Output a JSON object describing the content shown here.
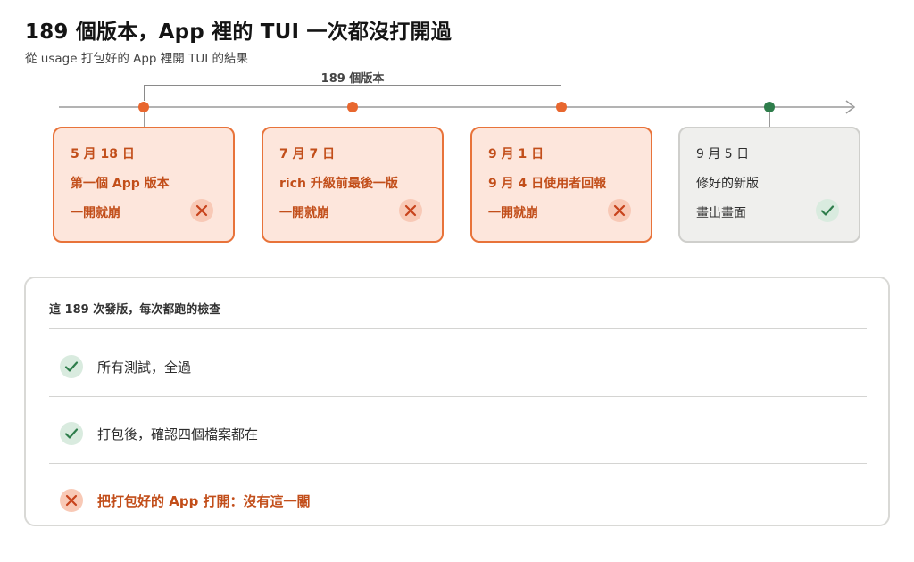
{
  "title": "189 個版本，App 裡的 TUI 一次都沒打開過",
  "subtitle": "從 usage 打包好的 App 裡開 TUI 的結果",
  "bracket_label": "189 個版本",
  "colors": {
    "fail_accent": "#e8672f",
    "fail_text": "#c24e1a",
    "ok_accent": "#2e7d4b"
  },
  "timeline": [
    {
      "date": "5 月 18 日",
      "name": "第一個 App 版本",
      "result": "一開就崩",
      "status": "fail",
      "icon": "x-icon"
    },
    {
      "date": "7 月 7 日",
      "name": "rich 升級前最後一版",
      "result": "一開就崩",
      "status": "fail",
      "icon": "x-icon"
    },
    {
      "date": "9 月 1 日",
      "name": "9 月 4 日使用者回報",
      "result": "一開就崩",
      "status": "fail",
      "icon": "x-icon"
    },
    {
      "date": "9 月 5 日",
      "name": "修好的新版",
      "result": "畫出畫面",
      "status": "ok",
      "icon": "check-icon"
    }
  ],
  "checks": {
    "header": "這 189 次發版，每次都跑的檢查",
    "items": [
      {
        "label": "所有測試，全過",
        "status": "pass",
        "icon": "check-icon"
      },
      {
        "label": "打包後，確認四個檔案都在",
        "status": "pass",
        "icon": "check-icon"
      },
      {
        "label": "把打包好的 App 打開：沒有這一關",
        "status": "missing",
        "icon": "x-icon"
      }
    ]
  }
}
